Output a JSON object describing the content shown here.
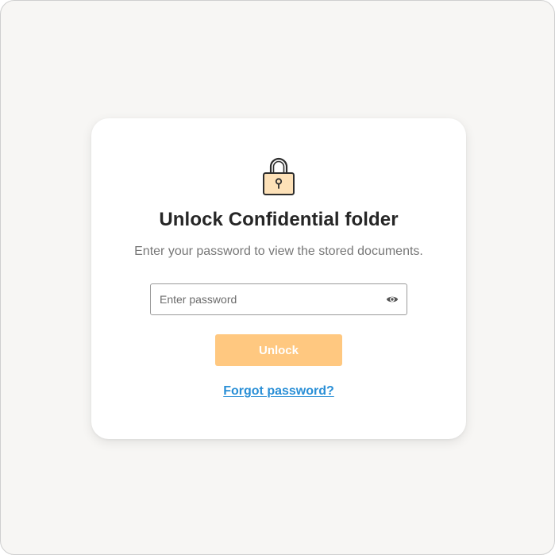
{
  "dialog": {
    "title": "Unlock Confidential folder",
    "subtitle": "Enter your password to view the stored documents.",
    "lock_icon": "padlock-icon",
    "password": {
      "value": "",
      "placeholder": "Enter password",
      "toggle_icon": "eye-icon"
    },
    "unlock_label": "Unlock",
    "forgot_label": "Forgot password?"
  },
  "colors": {
    "accent": "#ffc880",
    "link": "#2a8fd6",
    "lock_body": "#fde1b8",
    "background": "#f7f6f4"
  }
}
